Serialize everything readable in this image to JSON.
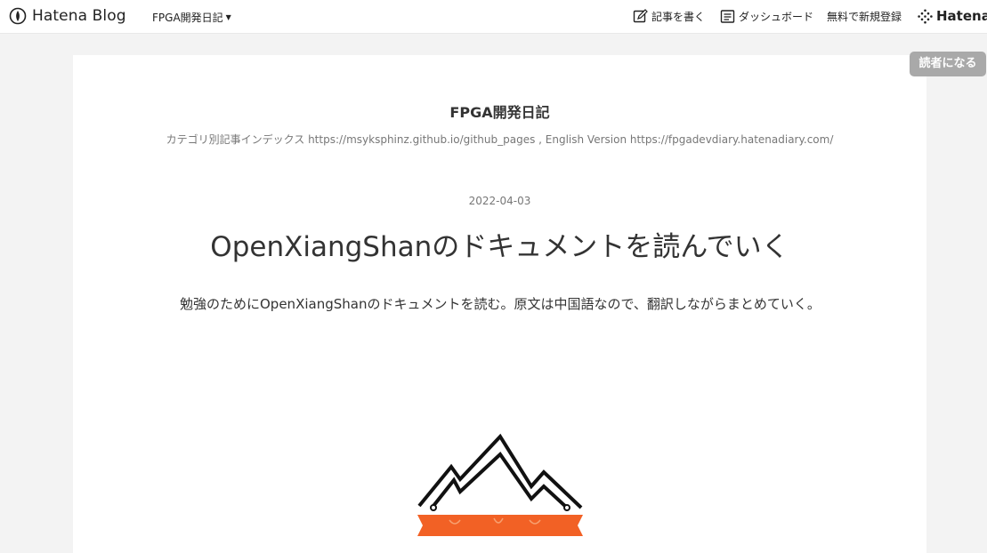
{
  "header": {
    "brand": "Hatena Blog",
    "blog_menu": "FPGA開発日記",
    "write_label": "記事を書く",
    "dashboard_label": "ダッシュボード",
    "signup_label": "無料で新規登録",
    "hatena_label": "Hatena"
  },
  "subscribe_label": "読者になる",
  "blog": {
    "title": "FPGA開発日記",
    "description": "カテゴリ別記事インデックス https://msyksphinz.github.io/github_pages , English Version https://fpgadevdiary.hatenadiary.com/"
  },
  "post": {
    "date": "2022-04-03",
    "title": "OpenXiangShanのドキュメントを読んでいく",
    "body": "勉強のためにOpenXiangShanのドキュメントを読む。原文は中国語なので、翻訳しながらまとめていく。"
  },
  "colors": {
    "accent_orange": "#f26125",
    "subscribe_bg": "#a9a9a9"
  }
}
